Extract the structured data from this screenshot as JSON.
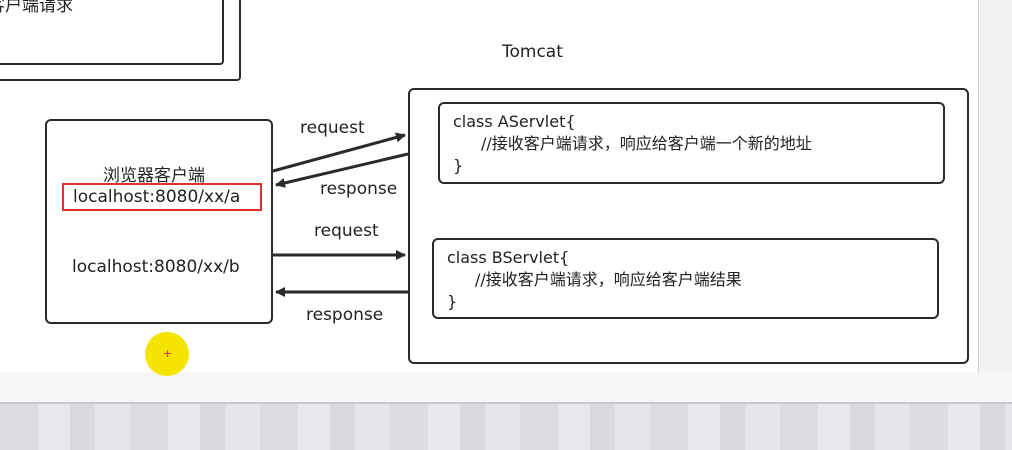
{
  "top_partial": {
    "label": "客户端请求"
  },
  "tomcat": {
    "title": "Tomcat"
  },
  "browser": {
    "title": "浏览器客户端",
    "url_a": "localhost:8080/xx/a",
    "url_b": "localhost:8080/xx/b"
  },
  "arrows": {
    "request_1": "request",
    "response_1": "response",
    "request_2": "request",
    "response_2": "response"
  },
  "aservlet": {
    "line1": "class AServlet{",
    "line2": "//接收客户端请求，响应给客户端一个新的地址",
    "line3": "}"
  },
  "bservlet": {
    "line1": "class BServlet{",
    "line2": "//接收客户端请求，响应给客户端结果",
    "line3": "}"
  },
  "colors": {
    "highlight": "#e0312c",
    "cursor": "#f5e400",
    "line": "#2a2a2a"
  }
}
